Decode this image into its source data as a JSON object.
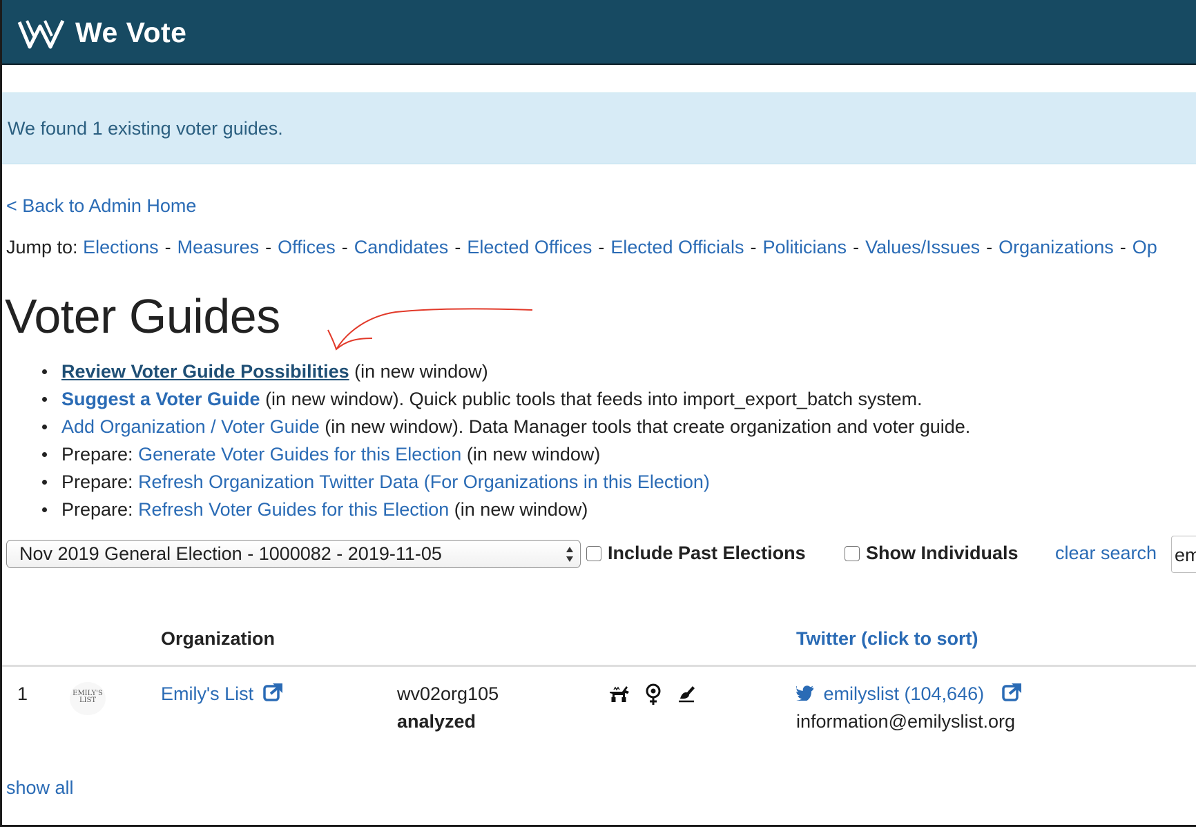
{
  "navbar": {
    "brand": "We Vote",
    "logo_icon": "we-vote-logo-icon",
    "bg_color": "#174a62"
  },
  "alert": {
    "message": "We found 1 existing voter guides.",
    "bg_color": "#d7ebf6"
  },
  "back_link": "< Back to Admin Home",
  "jump": {
    "label": "Jump to:",
    "separator": "-",
    "links": [
      "Elections",
      "Measures",
      "Offices",
      "Candidates",
      "Elected Offices",
      "Elected Officials",
      "Politicians",
      "Values/Issues",
      "Organizations",
      "Op"
    ]
  },
  "page_title": "Voter Guides",
  "actions": [
    {
      "prefix": "",
      "link": "Review Voter Guide Possibilities",
      "suffix": " (in new window)"
    },
    {
      "prefix": "",
      "link": "Suggest a Voter Guide",
      "suffix": " (in new window). Quick public tools that feeds into import_export_batch system."
    },
    {
      "prefix": "",
      "link": "Add Organization / Voter Guide",
      "suffix": " (in new window). Data Manager tools that create organization and voter guide."
    },
    {
      "prefix": "Prepare: ",
      "link": "Generate Voter Guides for this Election",
      "suffix": " (in new window)"
    },
    {
      "prefix": "Prepare: ",
      "link": "Refresh Organization Twitter Data (For Organizations in this Election)",
      "suffix": ""
    },
    {
      "prefix": "Prepare: ",
      "link": "Refresh Voter Guides for this Election",
      "suffix": " (in new window)"
    }
  ],
  "filters": {
    "election_select": "Nov 2019 General Election - 1000082 - 2019-11-05",
    "include_past_elections": {
      "label": "Include Past Elections",
      "checked": false
    },
    "show_individuals": {
      "label": "Show Individuals",
      "checked": false
    },
    "clear_search": "clear search",
    "search_value": "em"
  },
  "table": {
    "headers": {
      "organization": "Organization",
      "twitter": "Twitter (click to sort)"
    },
    "rows": [
      {
        "index": "1",
        "logo_text": "EMILY'S LIST",
        "organization": "Emily's List",
        "we_vote_id": "wv02org105",
        "status": "analyzed",
        "issue_icons": [
          "donkey-icon",
          "female-symbol-icon",
          "pen-hand-icon"
        ],
        "twitter_handle": "emilyslist (104,646)",
        "email": "information@emilyslist.org"
      }
    ]
  },
  "show_all": "show all",
  "accent_color": "#2a6bb5"
}
